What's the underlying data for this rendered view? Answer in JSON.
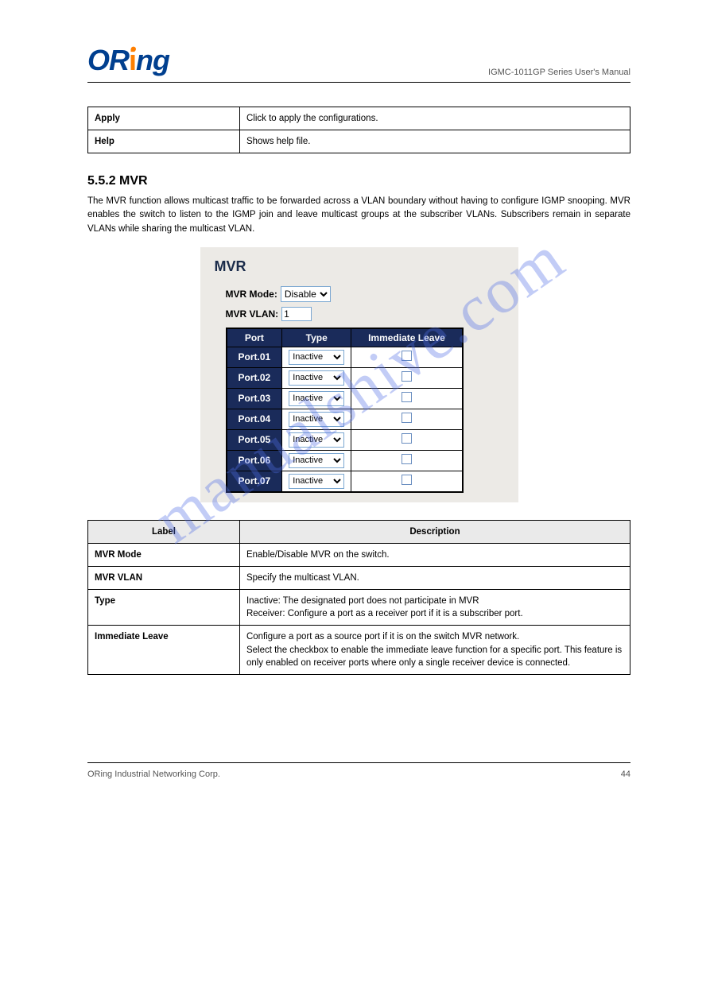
{
  "header": {
    "logo_o1": "O",
    "logo_r": "R",
    "logo_i_dash": "ı",
    "logo_ng": "ng",
    "right": "IGMC-1011GP Series User's Manual"
  },
  "table1": {
    "rows": [
      {
        "label": "Apply",
        "desc": "Click to apply the configurations."
      },
      {
        "label": "Help",
        "desc": "Shows help file."
      }
    ]
  },
  "section1_title": "5.5.2 MVR",
  "section1_para": "The MVR function allows multicast traffic to be forwarded across a VLAN boundary without having to configure IGMP snooping. MVR enables the switch to listen to the IGMP join and leave multicast groups at the subscriber VLANs. Subscribers remain in separate VLANs while sharing the multicast VLAN.",
  "mvr": {
    "panel_title": "MVR",
    "mode_label": "MVR Mode:",
    "mode_value": "Disable",
    "vlan_label": "MVR VLAN:",
    "vlan_value": "1",
    "headers": {
      "port": "Port",
      "type": "Type",
      "immediate": "Immediate Leave"
    },
    "type_default": "Inactive",
    "ports": [
      {
        "name": "Port.01"
      },
      {
        "name": "Port.02"
      },
      {
        "name": "Port.03"
      },
      {
        "name": "Port.04"
      },
      {
        "name": "Port.05"
      },
      {
        "name": "Port.06"
      },
      {
        "name": "Port.07"
      }
    ]
  },
  "table2": {
    "headers": {
      "label": "Label",
      "desc": "Description"
    },
    "rows": [
      {
        "label": "MVR Mode",
        "desc": "Enable/Disable MVR on the switch."
      },
      {
        "label": "MVR VLAN",
        "desc": "Specify the multicast VLAN."
      },
      {
        "label": "Type",
        "desc": "Inactive: The designated port does not participate in MVR\nReceiver: Configure a port as a receiver port if it is a subscriber port."
      },
      {
        "label": "Immediate Leave",
        "desc": "Configure a port as a source port if it is on the switch MVR network.\nSelect the checkbox to enable the immediate leave function for a specific port. This feature is only enabled on receiver ports where only a single receiver device is connected."
      }
    ]
  },
  "watermark": "manualshive.com",
  "footer": {
    "left": "ORing Industrial Networking Corp.",
    "right": "44"
  }
}
